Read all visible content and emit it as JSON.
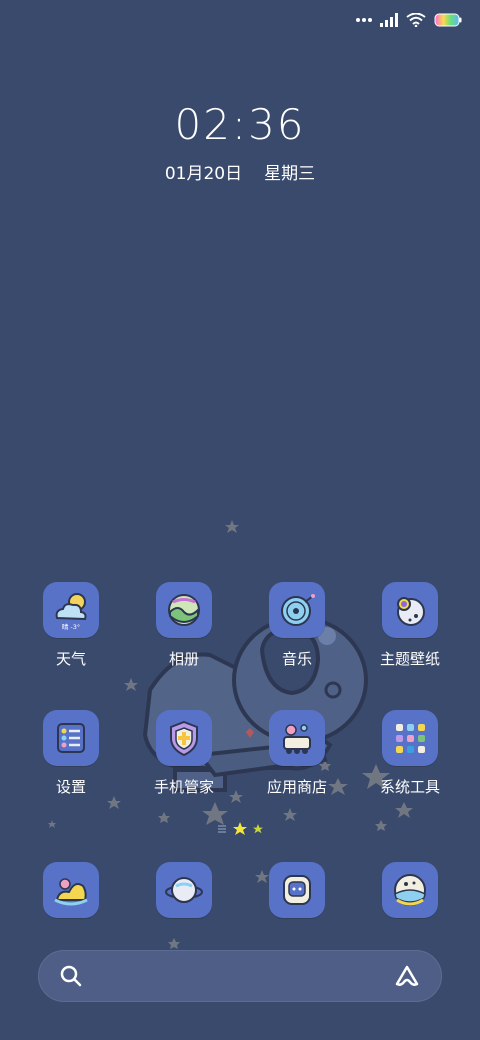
{
  "status": {
    "icons": [
      "dots-icon",
      "signal-icon",
      "wifi-icon",
      "battery-icon"
    ]
  },
  "clock": {
    "time": "02:36",
    "date": "01月20日",
    "weekday": "星期三"
  },
  "apps": [
    {
      "label": "天气",
      "icon": "weather-icon"
    },
    {
      "label": "相册",
      "icon": "gallery-icon"
    },
    {
      "label": "音乐",
      "icon": "music-icon"
    },
    {
      "label": "主题壁纸",
      "icon": "themes-icon"
    },
    {
      "label": "设置",
      "icon": "settings-icon"
    },
    {
      "label": "手机管家",
      "icon": "security-icon"
    },
    {
      "label": "应用商店",
      "icon": "app-store-icon"
    },
    {
      "label": "系统工具",
      "icon": "tools-folder-icon"
    }
  ],
  "weather_badge": "晴 -3°",
  "dock": [
    {
      "icon": "phone-dock-icon"
    },
    {
      "icon": "browser-dock-icon"
    },
    {
      "icon": "messages-dock-icon"
    },
    {
      "icon": "camera-dock-icon"
    }
  ],
  "search": {
    "icons": [
      "search-icon",
      "assistant-icon"
    ]
  },
  "colors": {
    "background": "#3a4a6c",
    "icon_bg": "#5872c8",
    "star_active": "#f5e63c"
  }
}
